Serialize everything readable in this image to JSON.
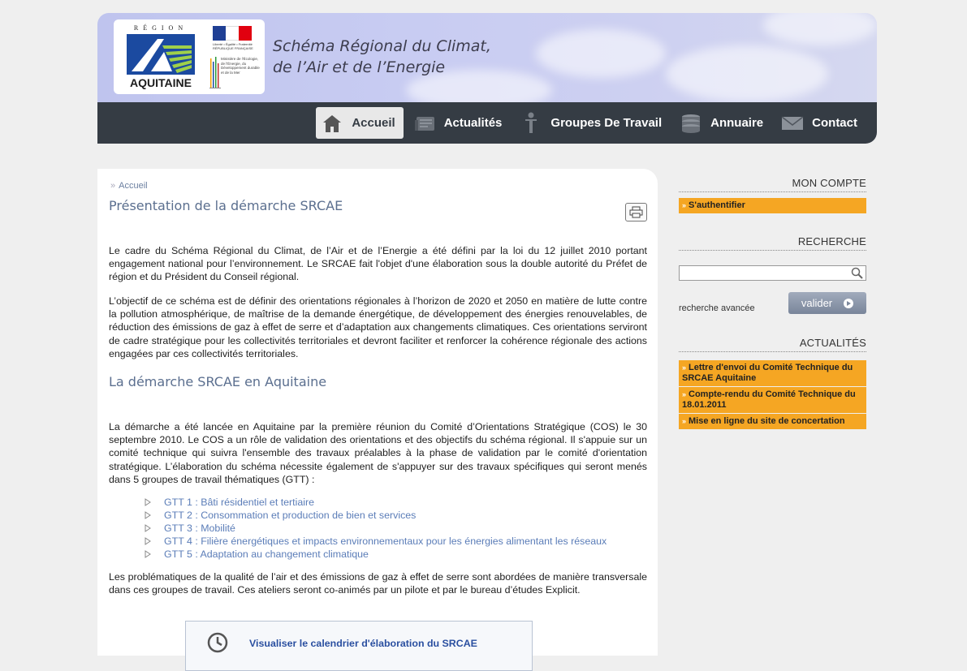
{
  "header": {
    "region_label": "RÉGION",
    "region_name": "AQUITAINE",
    "rf_caption": "Liberté • Égalité • Fraternité RÉPUBLIQUE FRANÇAISE",
    "ministry_caption": "Ministère de l'Écologie, de l'Énergie, du Développement durable et de la Mer",
    "title_line1": "Schéma Régional  du Climat,",
    "title_line2": "de l’Air et de l’Energie"
  },
  "nav": {
    "items": [
      {
        "label": "Accueil",
        "icon": "home-icon",
        "active": true
      },
      {
        "label": "Actualités",
        "icon": "newspaper-icon",
        "active": false
      },
      {
        "label": "Groupes De Travail",
        "icon": "person-icon",
        "active": false
      },
      {
        "label": "Annuaire",
        "icon": "database-icon",
        "active": false
      },
      {
        "label": "Contact",
        "icon": "envelope-icon",
        "active": false
      }
    ]
  },
  "content": {
    "breadcrumb_sep": "»",
    "breadcrumb": "Accueil",
    "heading1": "Présentation de la démarche SRCAE",
    "para1": "Le cadre du Schéma Régional du Climat, de l’Air et de l’Energie a été défini par la loi du 12 juillet 2010 portant engagement national pour l’environnement. Le SRCAE fait l'objet d'une élaboration sous la double autorité du Préfet de région et du Président du Conseil régional.",
    "para2": "L’objectif de ce schéma est de définir des orientations régionales à l’horizon de 2020 et 2050 en matière de lutte contre la pollution atmosphérique, de maîtrise de la demande énergétique, de développement des énergies renouvelables, de réduction des émissions de gaz à effet de serre et d’adaptation aux changements climatiques. Ces orientations serviront de cadre stratégique pour les collectivités territoriales et devront faciliter et renforcer la cohérence régionale des actions engagées par ces collectivités territoriales.",
    "heading2": "La démarche SRCAE en Aquitaine",
    "para3": "La démarche a été lancée en Aquitaine par la première réunion du Comité d’Orientations Stratégique (COS) le 30 septembre 2010. Le COS a un rôle de validation des orientations et des objectifs du schéma régional. Il s'appuie sur un comité technique qui suivra l'ensemble des travaux préalables à la phase de validation par le comité d'orientation stratégique. L’élaboration du schéma nécessite également de s'appuyer sur des travaux spécifiques qui seront menés dans 5 groupes de travail thématiques (GTT) :",
    "gtt": [
      "GTT 1 : Bâti résidentiel et tertiaire",
      "GTT 2 : Consommation et production de bien et services",
      "GTT 3 : Mobilité",
      "GTT 4 : Filière énergétiques et impacts environnementaux pour les énergies alimentant les réseaux",
      "GTT 5 : Adaptation au changement climatique"
    ],
    "para4": "Les problématiques de la qualité de l’air et des émissions de gaz à effet de serre sont abordées de manière transversale dans ces groupes de travail. Ces ateliers seront co-animés par un pilote et par le bureau d’études Explicit.",
    "calendar_link": "Visualiser le calendrier d'élaboration du SRCAE"
  },
  "sidebar": {
    "account_title": "MON COMPTE",
    "login_link": "S'authentifier",
    "search_title": "RECHERCHE",
    "search_value": "",
    "advanced_search": "recherche avancée",
    "validate_label": "valider",
    "news_title": "ACTUALITÉS",
    "news": [
      "Lettre d'envoi du Comité Technique du SRCAE Aquitaine",
      "Compte-rendu du Comité Technique du 18.01.2011",
      "Mise en ligne du site de concertation"
    ]
  },
  "colors": {
    "nav_bg": "#353c44",
    "accent_orange": "#f5a623",
    "heading_blue": "#5b6f8f",
    "link_blue": "#5b7db8"
  }
}
